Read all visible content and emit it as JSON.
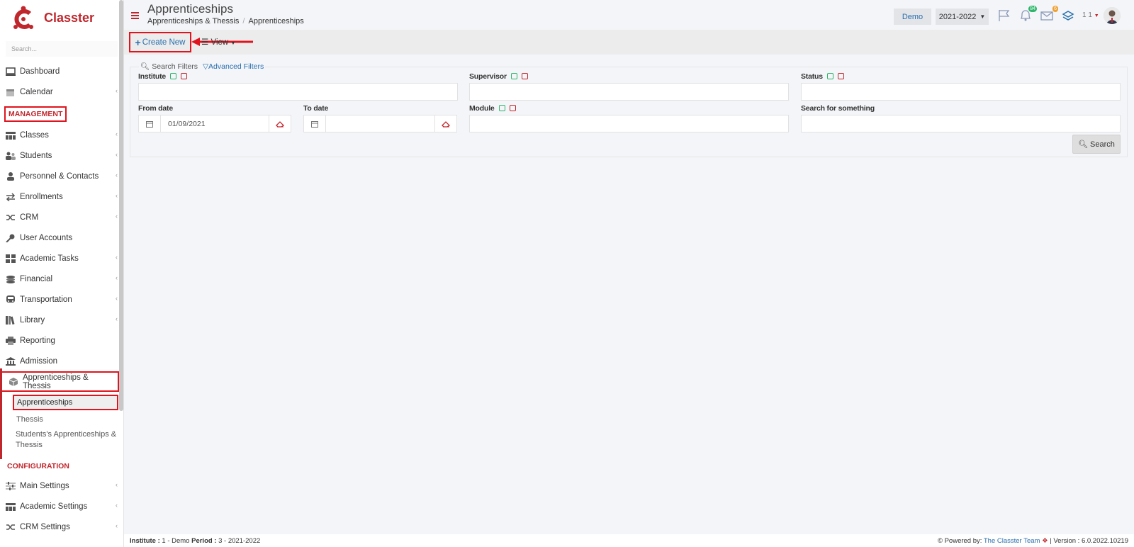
{
  "brand": {
    "name": "Classter"
  },
  "sidebar": {
    "search_placeholder": "Search...",
    "top_items": [
      {
        "label": "Dashboard",
        "icon": "laptop-icon"
      },
      {
        "label": "Calendar",
        "icon": "calendar-icon"
      }
    ],
    "management_title": "MANAGEMENT",
    "management_items": [
      {
        "label": "Classes",
        "icon": "classes-icon"
      },
      {
        "label": "Students",
        "icon": "students-icon"
      },
      {
        "label": "Personnel & Contacts",
        "icon": "person-icon"
      },
      {
        "label": "Enrollments",
        "icon": "exchange-icon"
      },
      {
        "label": "CRM",
        "icon": "shuffle-icon"
      },
      {
        "label": "User Accounts",
        "icon": "key-icon"
      },
      {
        "label": "Academic Tasks",
        "icon": "grid-icon"
      },
      {
        "label": "Financial",
        "icon": "coins-icon"
      },
      {
        "label": "Transportation",
        "icon": "bus-icon"
      },
      {
        "label": "Library",
        "icon": "books-icon"
      },
      {
        "label": "Reporting",
        "icon": "printer-icon"
      },
      {
        "label": "Admission",
        "icon": "bank-icon"
      }
    ],
    "active_item": {
      "label": "Apprenticeships & Thessis",
      "icon": "cube-icon"
    },
    "sub_items": [
      "Apprenticeships",
      "Thessis",
      "Students's Apprenticeships & Thessis"
    ],
    "configuration_title": "CONFIGURATION",
    "config_items": [
      {
        "label": "Main Settings",
        "icon": "sliders-icon"
      },
      {
        "label": "Academic Settings",
        "icon": "classes-icon"
      },
      {
        "label": "CRM Settings",
        "icon": "shuffle-icon"
      }
    ]
  },
  "header": {
    "title": "Apprenticeships",
    "breadcrumb": [
      "Apprenticeships & Thessis",
      "Apprenticeships"
    ],
    "demo_label": "Demo",
    "year_label": "2021-2022",
    "notif_count": "84",
    "mail_count": "6",
    "user_label": "1 1"
  },
  "toolbar": {
    "create_label": "Create New",
    "view_label": "View"
  },
  "filters": {
    "search_filters_label": "Search Filters",
    "advanced_filters_label": "Advanced Filters",
    "institute_label": "Institute",
    "supervisor_label": "Supervisor",
    "status_label": "Status",
    "from_date_label": "From date",
    "from_date_value": "01/09/2021",
    "to_date_label": "To date",
    "to_date_value": "",
    "module_label": "Module",
    "search_something_label": "Search for something",
    "search_button_label": "Search"
  },
  "footer": {
    "institute_key": "Institute :",
    "institute_val": "1 - Demo",
    "period_key": "Period :",
    "period_val": "3 - 2021-2022",
    "powered_by": "Powered by:",
    "team": "The Classter Team",
    "version": "| Version : 6.0.2022.10219"
  },
  "colors": {
    "brand_red": "#c0272d",
    "link_blue": "#2a6fae",
    "highlight_red": "#e0141e",
    "check_green": "#2db56a"
  }
}
